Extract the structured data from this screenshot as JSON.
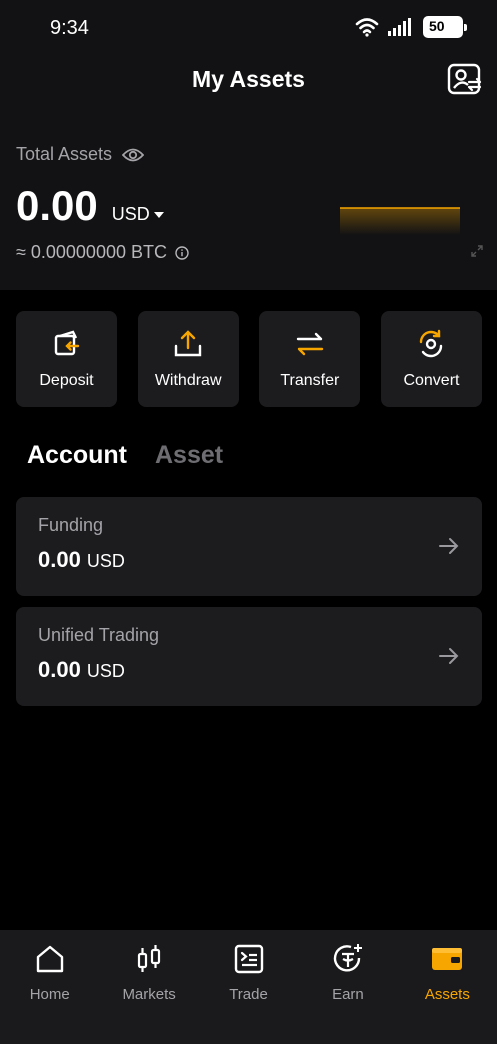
{
  "status": {
    "time": "9:34",
    "battery": "50"
  },
  "header": {
    "title": "My Assets"
  },
  "total": {
    "label": "Total Assets",
    "amount": "0.00",
    "currency": "USD",
    "btc": "≈ 0.00000000 BTC"
  },
  "actions": [
    {
      "label": "Deposit",
      "icon": "deposit-icon"
    },
    {
      "label": "Withdraw",
      "icon": "withdraw-icon"
    },
    {
      "label": "Transfer",
      "icon": "transfer-icon"
    },
    {
      "label": "Convert",
      "icon": "convert-icon"
    }
  ],
  "tabs": [
    {
      "label": "Account",
      "active": true
    },
    {
      "label": "Asset",
      "active": false
    }
  ],
  "accounts": [
    {
      "title": "Funding",
      "amount": "0.00",
      "currency": "USD"
    },
    {
      "title": "Unified Trading",
      "amount": "0.00",
      "currency": "USD"
    }
  ],
  "nav": [
    {
      "label": "Home",
      "icon": "home-icon"
    },
    {
      "label": "Markets",
      "icon": "markets-icon"
    },
    {
      "label": "Trade",
      "icon": "trade-icon"
    },
    {
      "label": "Earn",
      "icon": "earn-icon"
    },
    {
      "label": "Assets",
      "icon": "wallet-icon",
      "active": true
    }
  ],
  "colors": {
    "accent": "#f7a600",
    "background": "#000000",
    "card": "#1c1c1f"
  }
}
